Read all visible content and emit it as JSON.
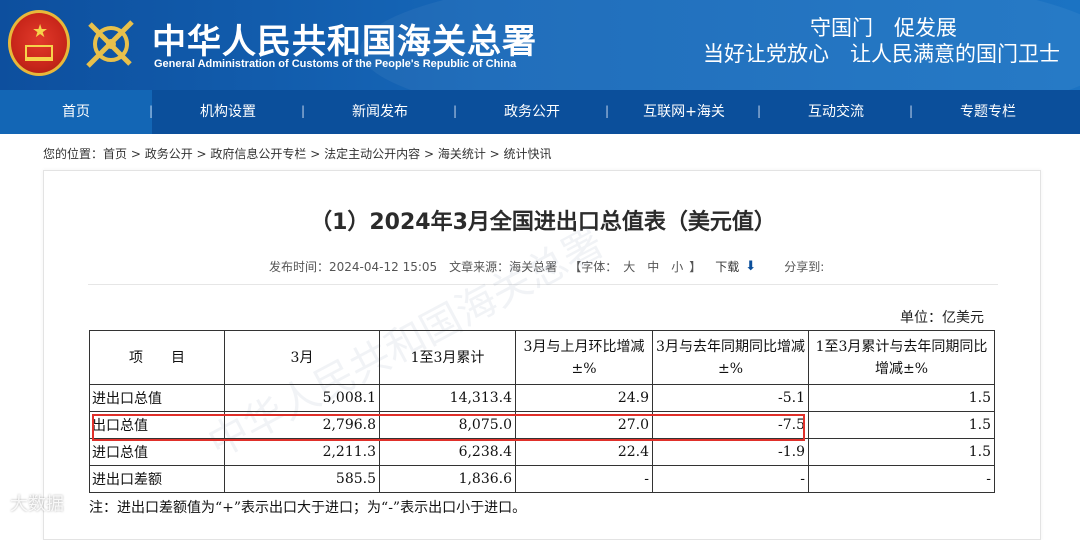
{
  "header": {
    "title_cn": "中华人民共和国海关总署",
    "title_en": "General Administration of Customs of the People's Republic of China",
    "slogan_line1": "守国门　促发展",
    "slogan_line2": "当好让党放心　让人民满意的国门卫士",
    "colors": {
      "header_bg": "#1667b8",
      "nav_bg": "#0b4f9b",
      "active_tab": "#1366b5"
    }
  },
  "nav": {
    "items": [
      {
        "label": "首页"
      },
      {
        "label": "机构设置"
      },
      {
        "label": "新闻发布"
      },
      {
        "label": "政务公开"
      },
      {
        "label": "互联网+海关"
      },
      {
        "label": "互动交流"
      },
      {
        "label": "专题专栏"
      }
    ],
    "separator": "|"
  },
  "breadcrumb": {
    "prefix": "您的位置：",
    "items": [
      "首页",
      "政务公开",
      "政府信息公开专栏",
      "法定主动公开内容",
      "海关统计",
      "统计快讯"
    ],
    "sep": " > "
  },
  "article": {
    "title": "（1）2024年3月全国进出口总值表（美元值）",
    "publish_label": "发布时间：",
    "publish_time": "2024-04-12 15:05",
    "source_label": "文章来源：",
    "source": "海关总署",
    "font_label": "【字体：",
    "font_large": "大",
    "font_medium": "中",
    "font_small": "小",
    "font_close": "】",
    "download": "下载",
    "download_icon": "download-arrow-icon",
    "share": "分享到:",
    "unit": "单位：亿美元"
  },
  "table": {
    "headers": [
      "项　　目",
      "3月",
      "1至3月累计",
      "3月与上月环比增减±%",
      "3月与去年同期同比增减±%",
      "1至3月累计与去年同期同比增减±%"
    ],
    "rows": [
      {
        "label": "进出口总值",
        "cells": [
          "5,008.1",
          "14,313.4",
          "24.9",
          "-5.1",
          "1.5"
        ]
      },
      {
        "label": "出口总值",
        "cells": [
          "2,796.8",
          "8,075.0",
          "27.0",
          "-7.5",
          "1.5"
        ]
      },
      {
        "label": "进口总值",
        "cells": [
          "2,211.3",
          "6,238.4",
          "22.4",
          "-1.9",
          "1.5"
        ]
      },
      {
        "label": "进出口差额",
        "cells": [
          "585.5",
          "1,836.6",
          "-",
          "-",
          "-"
        ]
      }
    ],
    "highlight_color": "#e0302a",
    "note": "注：进出口差额值为“+”表示出口大于进口；为“-”表示出口小于进口。"
  },
  "watermark": {
    "text": "中华人民共和国海关总署",
    "corner": "大数据"
  }
}
